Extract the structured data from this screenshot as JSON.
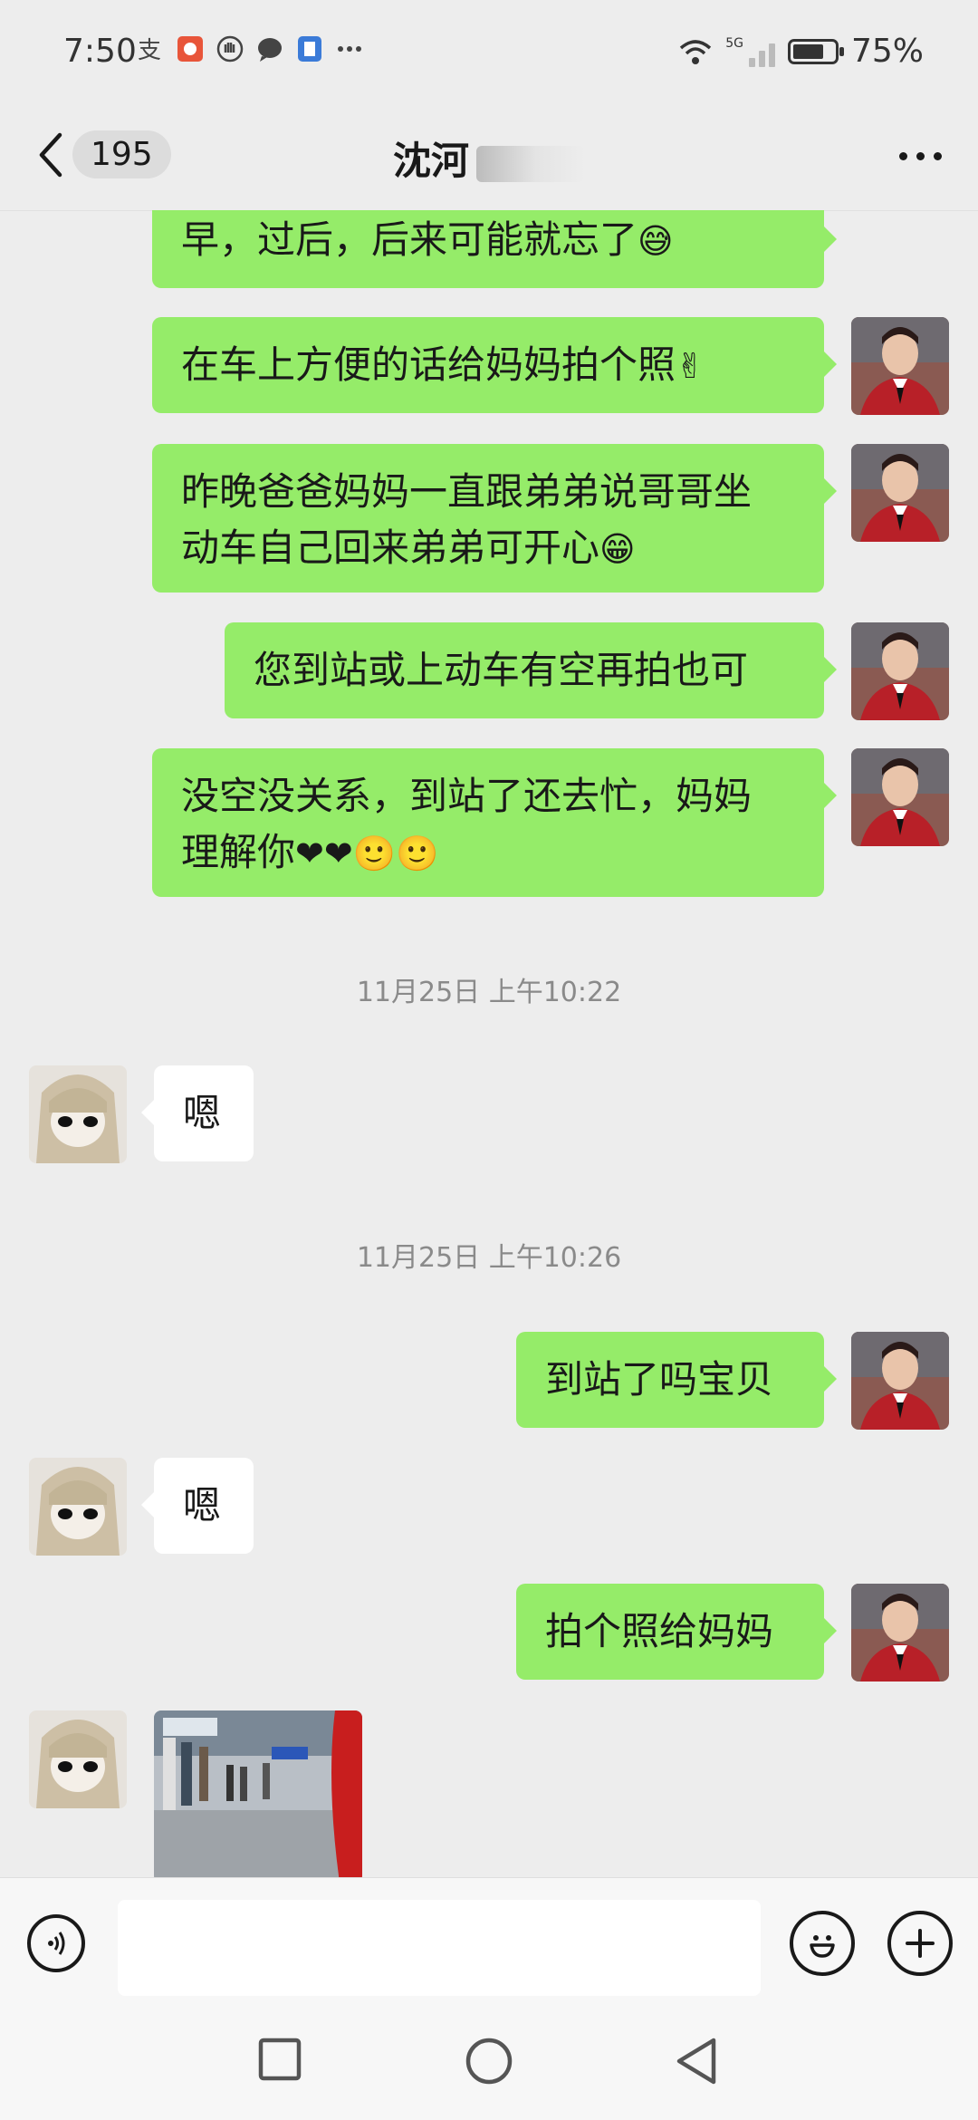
{
  "status_bar": {
    "time": "7:50",
    "battery": "75%",
    "battery_level": 0.75,
    "network": "5G",
    "icons": [
      "alipay-icon",
      "app-icon",
      "hand-icon",
      "chat-icon",
      "doc-icon",
      "more-dots-icon"
    ]
  },
  "header": {
    "back_count": "195",
    "title": "沈河"
  },
  "messages": [
    {
      "side": "right",
      "lines": [
        "早，过后，后来可能就忘了"
      ],
      "emoji": "😅",
      "partial": true
    },
    {
      "side": "right",
      "lines": [
        "在车上方便的话给妈妈拍个照"
      ],
      "emoji": "✌"
    },
    {
      "side": "right",
      "lines": [
        "昨晚爸爸妈妈一直跟弟弟说哥哥坐",
        "动车自己回来弟弟可开心"
      ],
      "emoji": "😁"
    },
    {
      "side": "right",
      "lines": [
        "您到站或上动车有空再拍也可"
      ]
    },
    {
      "side": "right",
      "lines": [
        "没空没关系，到站了还去忙，妈妈",
        "理解你"
      ],
      "emoji": "❤❤🙂🙂"
    },
    {
      "type": "time",
      "text": "11月25日 上午10:22"
    },
    {
      "side": "left",
      "lines": [
        "嗯"
      ]
    },
    {
      "type": "time",
      "text": "11月25日 上午10:26"
    },
    {
      "side": "right",
      "lines": [
        "到站了吗宝贝"
      ]
    },
    {
      "side": "left",
      "lines": [
        "嗯"
      ]
    },
    {
      "side": "right",
      "lines": [
        "拍个照给妈妈"
      ]
    },
    {
      "side": "left",
      "type": "image",
      "alt": "photo-message"
    }
  ],
  "m0": {
    "text": "早，过后，后来可能就忘了",
    "emoji": "😅"
  },
  "m1": {
    "text": "在车上方便的话给妈妈拍个照",
    "emoji": "✌"
  },
  "m2": {
    "line1": "昨晚爸爸妈妈一直跟弟弟说哥哥坐",
    "line2": "动车自己回来弟弟可开心",
    "emoji": "😁"
  },
  "m3": {
    "text": "您到站或上动车有空再拍也可"
  },
  "m4": {
    "line1": "没空没关系，到站了还去忙，妈妈",
    "line2": "理解你",
    "emoji": "❤❤🙂🙂"
  },
  "t1": "11月25日 上午10:22",
  "m5": {
    "text": "嗯"
  },
  "t2": "11月25日 上午10:26",
  "m6": {
    "text": "到站了吗宝贝"
  },
  "m7": {
    "text": "嗯"
  },
  "m8": {
    "text": "拍个照给妈妈"
  },
  "input": {
    "value": "",
    "placeholder": ""
  },
  "colors": {
    "sent_bubble": "#95ec69",
    "received_bubble": "#ffffff",
    "background": "#ededed"
  },
  "nav": {
    "icons": [
      "recent-apps-icon",
      "home-icon",
      "back-triangle-icon"
    ]
  }
}
